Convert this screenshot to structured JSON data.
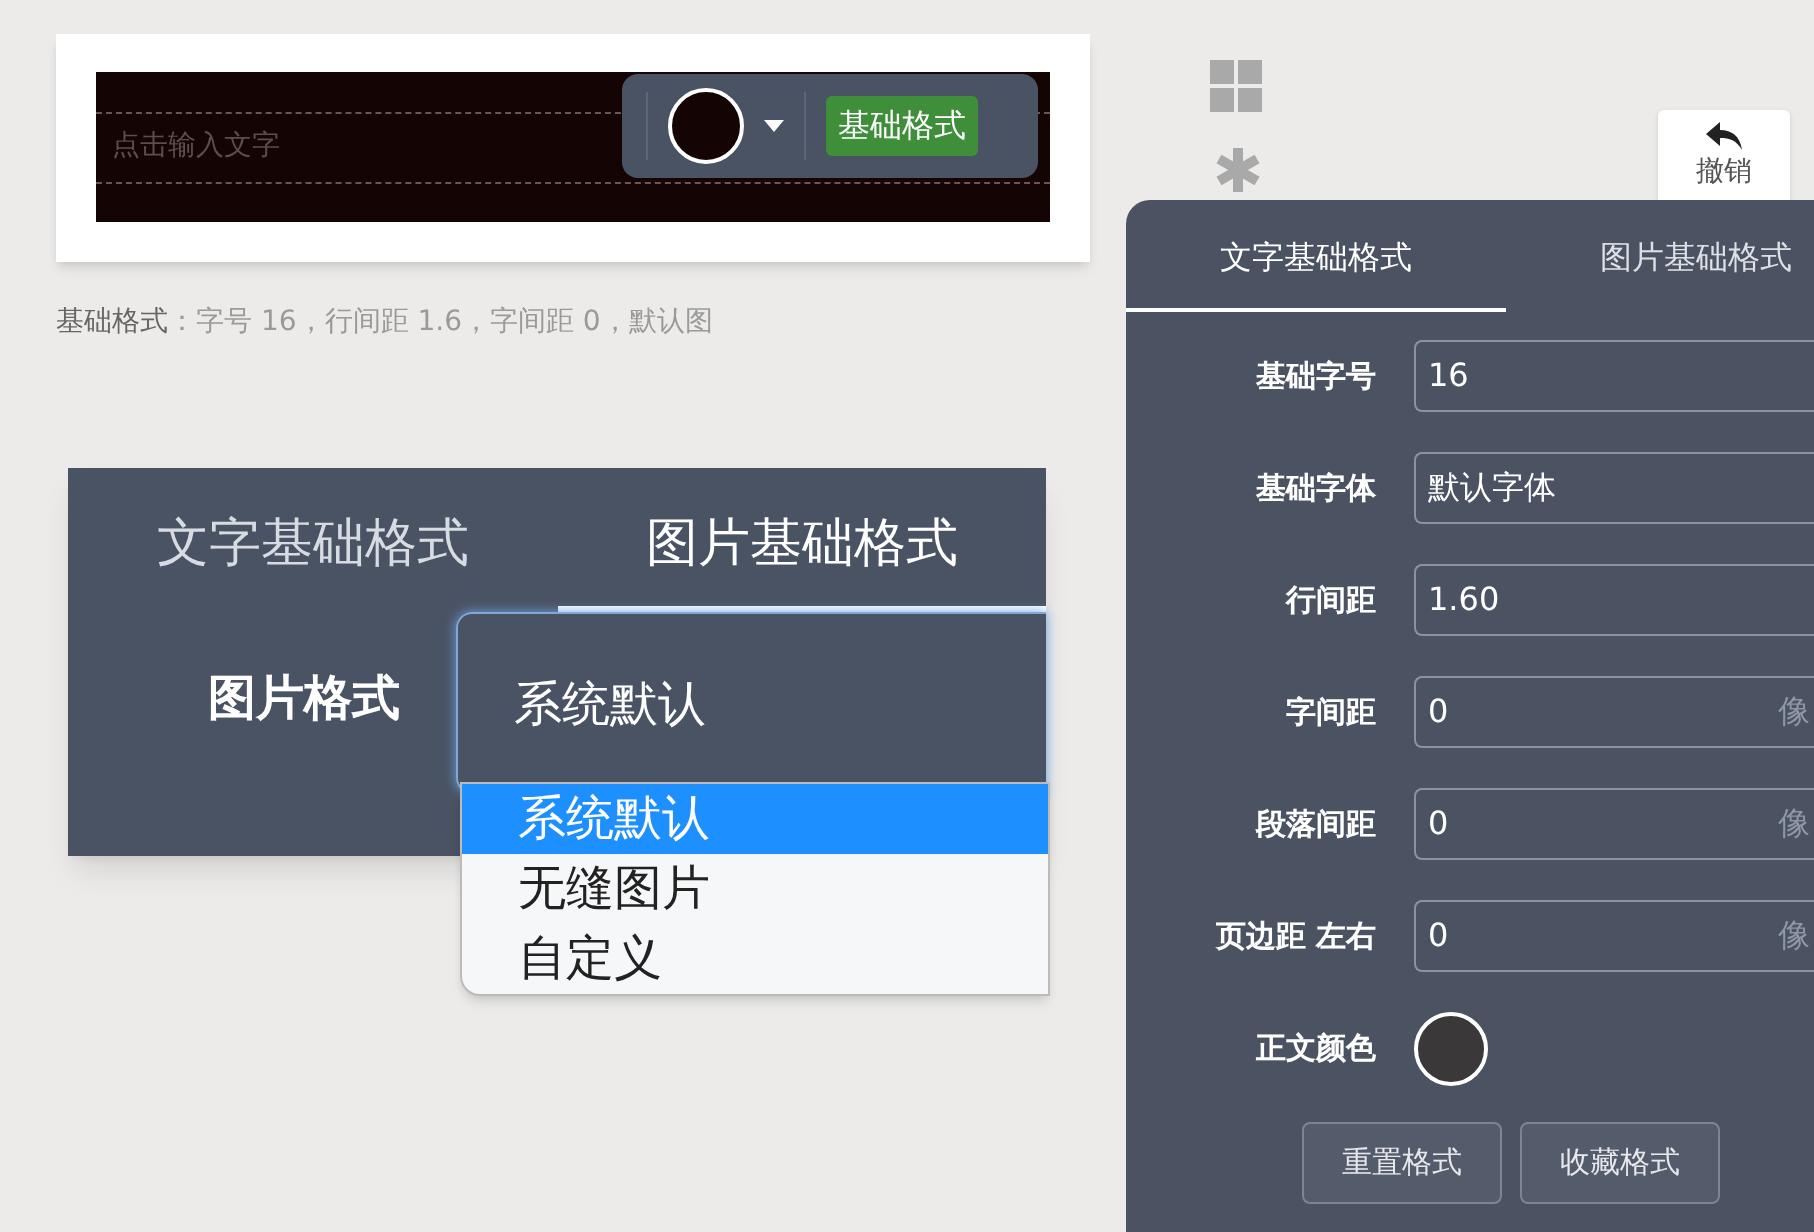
{
  "editor_card": {
    "placeholder": "点击输入文字",
    "toolbar": {
      "color": "#140404",
      "format_button": "基础格式"
    }
  },
  "caption": {
    "label": "基础格式",
    "text": "：字号 16，行间距 1.6，字间距 0，默认图"
  },
  "image_format_panel": {
    "tabs": [
      {
        "label": "文字基础格式",
        "selected": false
      },
      {
        "label": "图片基础格式",
        "selected": true
      }
    ],
    "field_label": "图片格式",
    "value": "系统默认",
    "options": [
      {
        "label": "系统默认",
        "selected": true
      },
      {
        "label": "无缝图片",
        "selected": false
      },
      {
        "label": "自定义",
        "selected": false
      }
    ]
  },
  "side_toolbar": {
    "undo_button": "撤销"
  },
  "format_panel": {
    "tabs": [
      {
        "label": "文字基础格式",
        "selected": true
      },
      {
        "label": "图片基础格式",
        "selected": false
      }
    ],
    "fields": [
      {
        "label": "基础字号",
        "value": "16"
      },
      {
        "label": "基础字体",
        "value": "默认字体"
      },
      {
        "label": "行间距",
        "value": "1.60"
      },
      {
        "label": "字间距",
        "value": "0",
        "unit": "像"
      },
      {
        "label": "段落间距",
        "value": "0",
        "unit": "像"
      },
      {
        "label": "页边距 左右",
        "value": "0",
        "unit": "像"
      }
    ],
    "text_color": {
      "label": "正文颜色",
      "color": "#3a3838"
    },
    "buttons": [
      "重置格式",
      "收藏格式"
    ]
  }
}
